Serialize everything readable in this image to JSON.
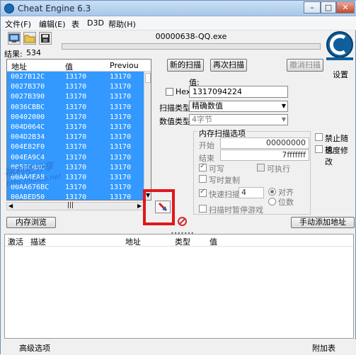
{
  "window": {
    "title": "Cheat Engine 6.3",
    "minimize": "–",
    "maximize": "□",
    "close": "✕"
  },
  "menu": [
    "文件(F)",
    "编辑(E)",
    "表",
    "D3D",
    "帮助(H)"
  ],
  "toolbar": {
    "icons": [
      "select-process-icon",
      "open-icon",
      "save-icon"
    ]
  },
  "process": {
    "name": "00000638-QQ.exe"
  },
  "logo": {
    "caption": "设置"
  },
  "results": {
    "label": "结果:",
    "count": "534"
  },
  "list": {
    "headers": [
      "地址",
      "值",
      "Previou"
    ],
    "rows": [
      [
        "0027B12C",
        "13170",
        "13170"
      ],
      [
        "0027B370",
        "13170",
        "13170"
      ],
      [
        "0027B390",
        "13170",
        "13170"
      ],
      [
        "0036CBBC",
        "13170",
        "13170"
      ],
      [
        "00402000",
        "13170",
        "13170"
      ],
      [
        "004D064C",
        "13170",
        "13170"
      ],
      [
        "004D2B34",
        "13170",
        "13170"
      ],
      [
        "004E82F0",
        "13170",
        "13170"
      ],
      [
        "004EA9C4",
        "13170",
        "13170"
      ],
      [
        "0059C0AC",
        "13170",
        "13170"
      ],
      [
        "00AA4EA8",
        "13170",
        "13170"
      ],
      [
        "00AA676BC",
        "13170",
        "13170"
      ],
      [
        "00ABED50",
        "13170",
        "13170"
      ]
    ]
  },
  "scan": {
    "new_scan": "新的扫描",
    "next_scan": "再次扫描",
    "undo_scan": "撤消扫描",
    "value_label": "值:",
    "hex_label": "Hex",
    "value": "1317094224",
    "scan_type_label": "扫描类型",
    "scan_type": "精确数值",
    "value_type_label": "数值类型",
    "value_type": "4字节"
  },
  "memory": {
    "title": "内存扫描选项",
    "start_label": "开始",
    "start": "00000000",
    "end_label": "结束",
    "end": "7fffffff",
    "writable": "可写",
    "executable": "可执行",
    "copy_on_write": "写时复制",
    "fast_scan": "快速扫描",
    "fast_scan_value": "4",
    "align": "对齐",
    "last_digits": "位数",
    "pause_game": "扫描时暂停游戏"
  },
  "options": {
    "disable_random": "禁止随机",
    "speedhack": "速度修改"
  },
  "buttons": {
    "memory_view": "内存浏览",
    "add_address": "手动添加地址"
  },
  "table": {
    "headers": [
      "激活",
      "描述",
      "地址",
      "类型",
      "值"
    ]
  },
  "status": {
    "advanced": "高级选项",
    "table_extras": "附加表"
  },
  "watermark": {
    "text": "福利吧分享",
    "url": "http://fuliba.net"
  },
  "colors": {
    "selection": "#3399ff",
    "highlight_box": "#e0171b"
  }
}
